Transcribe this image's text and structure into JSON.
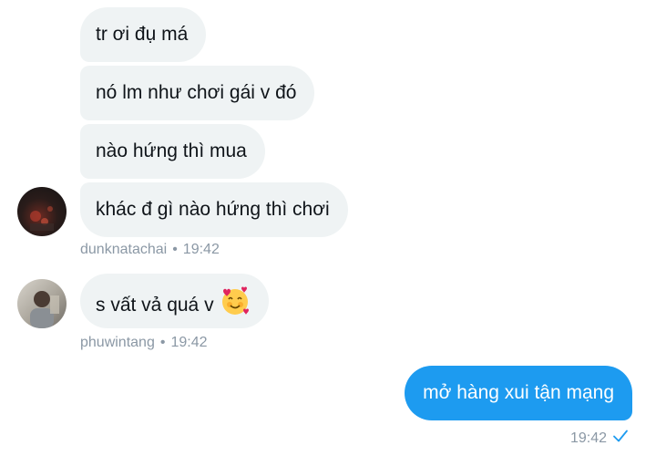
{
  "colors": {
    "incoming_bubble": "#eff3f4",
    "outgoing_bubble": "#1d9bf0",
    "meta_text": "#8b98a5",
    "check": "#1d9bf0"
  },
  "messages": [
    {
      "text": "tr ơi đụ má"
    },
    {
      "text": "nó lm như chơi gái v đó"
    },
    {
      "text": "nào hứng thì mua"
    },
    {
      "text": "khác đ gì nào hứng thì chơi"
    },
    {
      "text": "s vất vả quá v",
      "emoji_icon": "smiling-face-with-hearts-icon"
    },
    {
      "text": "mở hàng xui tận mạng"
    }
  ],
  "groups": [
    {
      "sender": "dunknatachai",
      "separator": "•",
      "time": "19:42"
    },
    {
      "sender": "phuwintang",
      "separator": "•",
      "time": "19:42"
    }
  ],
  "outgoing_meta": {
    "time": "19:42",
    "status_icon": "check-icon"
  }
}
